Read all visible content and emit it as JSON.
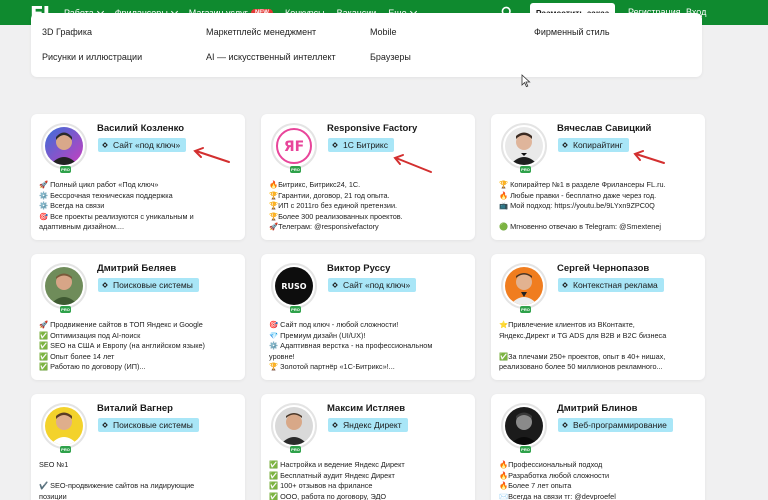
{
  "header": {
    "logo": "FL",
    "nav": [
      {
        "label": "Работа",
        "dropdown": true
      },
      {
        "label": "Фрилансеры",
        "dropdown": true
      },
      {
        "label": "Магазин услуг",
        "badge": "NEW"
      },
      {
        "label": "Конкурсы",
        "dropdown": false
      },
      {
        "label": "Вакансии",
        "dropdown": false
      },
      {
        "label": "Еще",
        "dropdown": true
      }
    ],
    "place_order": "Разместить заказ",
    "register": "Регистрация",
    "login": "Вход"
  },
  "categories": [
    "3D Графика",
    "Маркетплейс менеджмент",
    "Mobile",
    "Фирменный стиль",
    "Рисунки и иллюстрации",
    "AI — искусственный интеллект",
    "Браузеры"
  ],
  "cards": [
    {
      "name": "Василий Козленко",
      "spec": "Сайт «под ключ»",
      "lines": [
        "🚀 Полный цикл работ «Под ключ»",
        "⚙️ Бессрочная техническая поддержка",
        "⚙️ Всегда на связи",
        "🎯 Все проекты реализуются с уникальным и",
        "адаптивным дизайном...."
      ]
    },
    {
      "name": "Responsive Factory",
      "spec": "1С Битрикс",
      "lines": [
        "🔥Битрикс, Битрикс24, 1С.",
        "🏆Гарантии, договор, 21 год опыта.",
        "🏆ИП с 2011го без единой претензии.",
        "🏆Более 300 реализованных проектов.",
        "🚀Телеграм: @responsivefactory"
      ]
    },
    {
      "name": "Вячеслав Савицкий",
      "spec": "Копирайтинг",
      "lines": [
        "🏆 Копирайтер №1 в разделе Фрилансеры FL.ru.",
        "🔥 Любые правки - бесплатно даже через год.",
        "📺 Мой подход: https://youtu.be/9LYxn9ZPC0Q",
        "",
        "🟢 Мгновенно отвечаю в Telegram: @Smextenej"
      ]
    },
    {
      "name": "Дмитрий Беляев",
      "spec": "Поисковые системы",
      "lines": [
        "🚀 Продвижение сайтов в ТОП Яндекс и Google",
        "✅ Оптимизация под AI-поиск",
        "✅ SEO на США и Европу (на английском языке)",
        "✅ Опыт более 14 лет",
        "✅ Работаю по договору (ИП)..."
      ]
    },
    {
      "name": "Виктор Руссу",
      "spec": "Сайт «под ключ»",
      "lines": [
        "🎯 Сайт под ключ - любой сложности!",
        "💎 Премиум дизайн (UI/UX)!",
        "⚙️ Адаптивная верстка - на профессиональном",
        "уровне!",
        "🏆 Золотой партнёр «1С-Битрикс»!..."
      ]
    },
    {
      "name": "Сергей Чернопазов",
      "spec": "Контекстная реклама",
      "lines": [
        "⭐Привлечение клиентов из ВКонтакте,",
        "Яндекс.Директ и TG ADS для B2B и B2C бизнеса",
        "",
        "✅За плечами 250+ проектов, опыт в 40+ нишах,",
        "реализовано более 50 миллионов рекламного..."
      ]
    },
    {
      "name": "Виталий Вагнер",
      "spec": "Поисковые системы",
      "lines": [
        "SEO №1",
        "",
        "✔️ SEO-продвижение сайтов на лидирующие",
        "позиции"
      ]
    },
    {
      "name": "Максим Истляев",
      "spec": "Яндекс Директ",
      "lines": [
        "✅ Настройка и ведение Яндекс Директ",
        "✅ Бесплатный аудит Яндекс Директ",
        "✅ 100+ отзывов на фрилансе",
        "✅ ООО, работа по договору, ЭДО"
      ]
    },
    {
      "name": "Дмитрий Блинов",
      "spec": "Веб-программирование",
      "lines": [
        "🔥Профессиональный подход",
        "🔥Разработка любой сложности",
        "🔥Более 7 лет опыта",
        "✉️Всегда на связи тг: @devproefel"
      ]
    }
  ],
  "avatar_badge": "PRO",
  "colors": {
    "header": "#0f8a2f",
    "spec_tag": "#a9e6f7",
    "pro_badge": "#2fa14a",
    "arrow": "#d32f2f",
    "background": "#f0f0f1"
  }
}
